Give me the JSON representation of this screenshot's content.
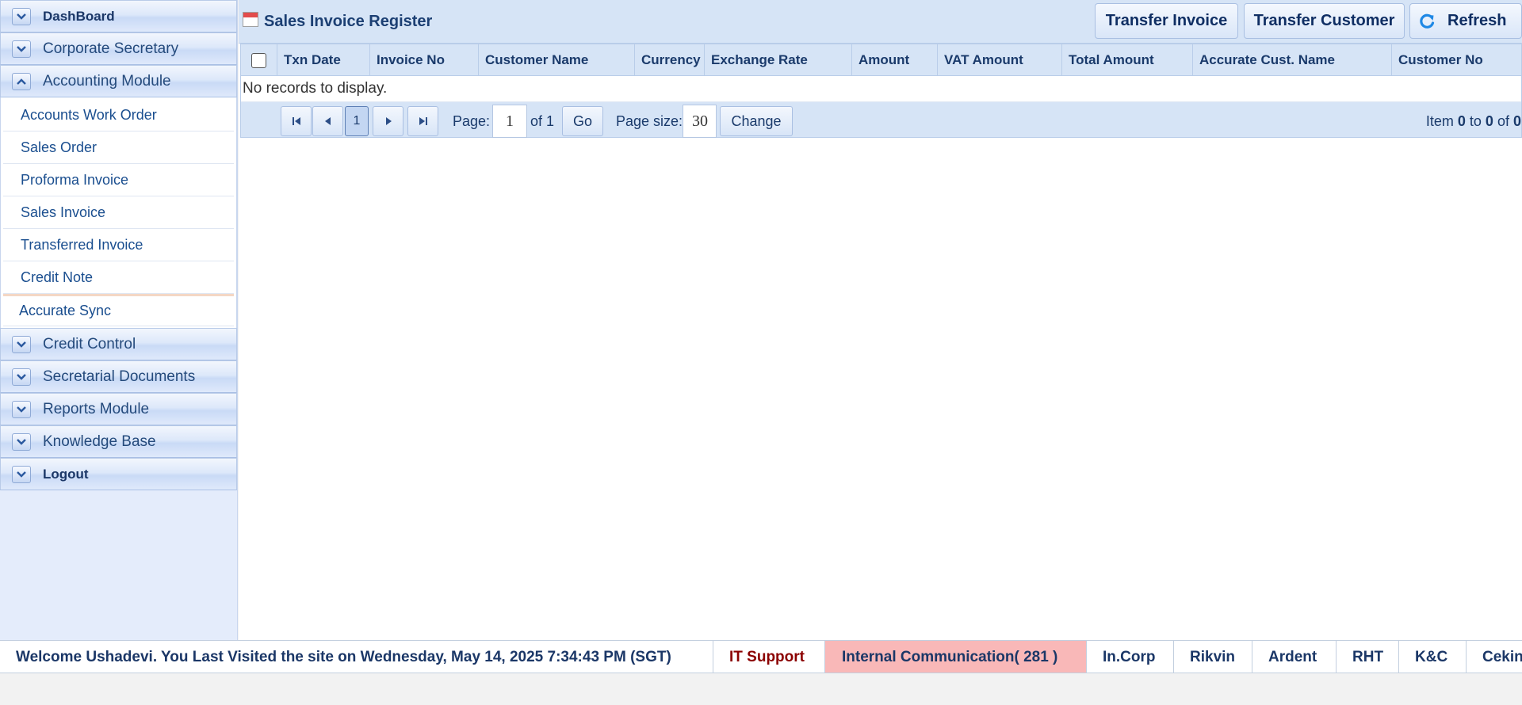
{
  "sidebar": {
    "panels_top": [
      {
        "title": "DashBoard",
        "bold": true,
        "icon": "chevron-down-icon"
      },
      {
        "title": "Corporate Secretary",
        "bold": false,
        "icon": "chevron-down-icon"
      },
      {
        "title": "Accounting Module",
        "bold": false,
        "icon": "chevron-up-icon"
      }
    ],
    "accounting_items": [
      "Accounts Work Order",
      "Sales Order",
      "Proforma Invoice",
      "Sales Invoice",
      "Transferred Invoice",
      "Credit Note",
      "Accurate Sync"
    ],
    "panels_bottom": [
      {
        "title": "Credit Control",
        "bold": false,
        "icon": "chevron-down-icon"
      },
      {
        "title": "Secretarial Documents",
        "bold": false,
        "icon": "chevron-down-icon"
      },
      {
        "title": "Reports Module",
        "bold": false,
        "icon": "chevron-down-icon"
      },
      {
        "title": "Knowledge Base",
        "bold": false,
        "icon": "chevron-down-icon"
      },
      {
        "title": "Logout",
        "bold": true,
        "icon": "chevron-down-icon"
      }
    ]
  },
  "main": {
    "title": "Sales Invoice Register",
    "title_icon": "calendar-icon",
    "toolbar": {
      "transfer_invoice": "Transfer Invoice",
      "transfer_customer": "Transfer Customer",
      "refresh": "Refresh",
      "refresh_icon": "refresh-icon"
    },
    "grid": {
      "columns": [
        "Txn Date",
        "Invoice No",
        "Customer Name",
        "Currency",
        "Exchange Rate",
        "Amount",
        "VAT Amount",
        "Total Amount",
        "Accurate Cust. Name",
        "Customer No"
      ],
      "empty_message": "No records to display."
    },
    "pager": {
      "current_page_button": "1",
      "page_label": "Page:",
      "page_value": "1",
      "of_label": "of 1",
      "go": "Go",
      "page_size_label": "Page size:",
      "page_size_value": "30",
      "change": "Change",
      "info_prefix": "Item",
      "info_from": "0",
      "info_to_label": "to",
      "info_to": "0",
      "info_of_label": "of",
      "info_total": "0"
    }
  },
  "footer": {
    "welcome": "Welcome Ushadevi. You Last Visited the site on Wednesday, May 14, 2025 7:34:43 PM (SGT)",
    "it_support": "IT Support",
    "internal_communication": "Internal Communication( 281 )",
    "links": [
      "In.Corp",
      "Rikvin",
      "Ardent",
      "RHT",
      "K&C",
      "Cekin"
    ]
  },
  "colors": {
    "accent": "#1b3767",
    "header_bg": "#d6e4f6",
    "sidebar_bg": "#e4ecfb",
    "alert_bg": "#f9b8b8",
    "it_support": "#8b0000"
  }
}
